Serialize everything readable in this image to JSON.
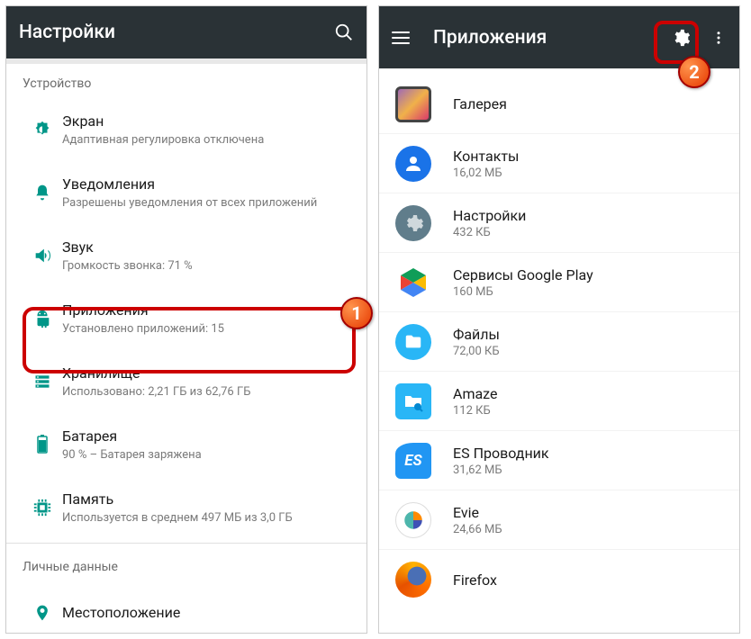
{
  "left": {
    "appbar_title": "Настройки",
    "section_device": "Устройство",
    "section_personal": "Личные данные",
    "items": {
      "display": {
        "title": "Экран",
        "sub": "Адаптивная регулировка отключена"
      },
      "notifications": {
        "title": "Уведомления",
        "sub": "Разрешены уведомления от всех приложений"
      },
      "sound": {
        "title": "Звук",
        "sub": "Громкость звонка: 71 %"
      },
      "apps": {
        "title": "Приложения",
        "sub": "Установлено приложений: 15"
      },
      "storage": {
        "title": "Хранилище",
        "sub": "Использовано: 2,21 ГБ из 62,76 ГБ"
      },
      "battery": {
        "title": "Батарея",
        "sub": "90 % – Батарея заряжена"
      },
      "memory": {
        "title": "Память",
        "sub": "Используется в среднем 497 МБ из 3,0 ГБ"
      },
      "location": {
        "title": "Местоположение",
        "sub": ""
      }
    }
  },
  "right": {
    "appbar_title": "Приложения",
    "apps": [
      {
        "name": "Галерея",
        "size": ""
      },
      {
        "name": "Контакты",
        "size": "16,02 МБ"
      },
      {
        "name": "Настройки",
        "size": "432 КБ"
      },
      {
        "name": "Сервисы Google Play",
        "size": "160 МБ"
      },
      {
        "name": "Файлы",
        "size": "72,00 КБ"
      },
      {
        "name": "Amaze",
        "size": "112 КБ"
      },
      {
        "name": "ES Проводник",
        "size": "31,62 МБ"
      },
      {
        "name": "Evie",
        "size": "24,66 МБ"
      },
      {
        "name": "Firefox",
        "size": ""
      }
    ]
  },
  "badges": {
    "one": "1",
    "two": "2"
  }
}
